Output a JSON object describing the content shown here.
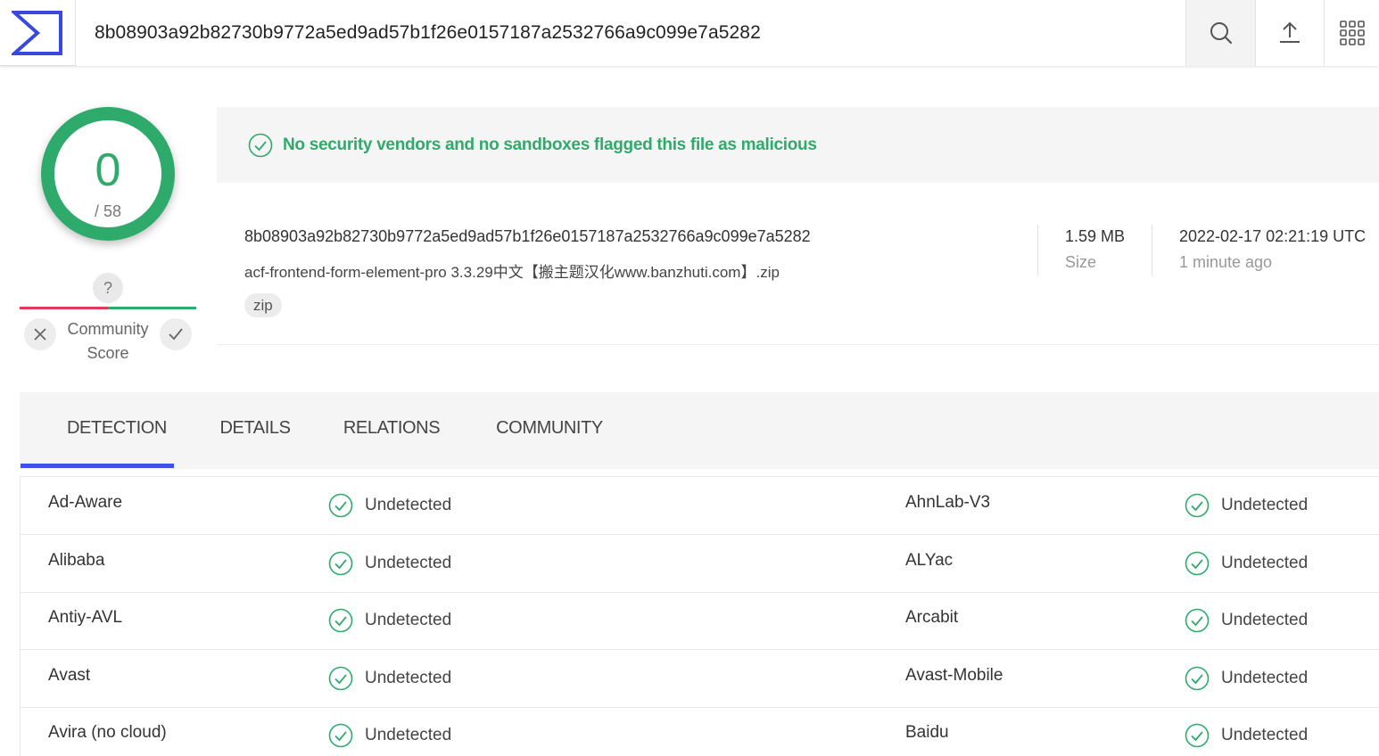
{
  "search": {
    "value": "8b08903a92b82730b9772a5ed9ad57b1f26e0157187a2532766a9c099e7a5282"
  },
  "score": {
    "detected": "0",
    "total": "/ 58"
  },
  "community": {
    "unknown": "?",
    "label": "Community Score"
  },
  "banner": {
    "text": "No security vendors and no sandboxes flagged this file as malicious"
  },
  "file": {
    "hash": "8b08903a92b82730b9772a5ed9ad57b1f26e0157187a2532766a9c099e7a5282",
    "name": "acf-frontend-form-element-pro 3.3.29中文【搬主题汉化www.banzhuti.com】.zip",
    "tag": "zip",
    "size": "1.59 MB",
    "size_label": "Size",
    "date": "2022-02-17 02:21:19 UTC",
    "date_ago": "1 minute ago"
  },
  "tabs": [
    "DETECTION",
    "DETAILS",
    "RELATIONS",
    "COMMUNITY"
  ],
  "detections": [
    [
      {
        "vendor": "Ad-Aware",
        "result": "Undetected"
      },
      {
        "vendor": "AhnLab-V3",
        "result": "Undetected"
      }
    ],
    [
      {
        "vendor": "Alibaba",
        "result": "Undetected"
      },
      {
        "vendor": "ALYac",
        "result": "Undetected"
      }
    ],
    [
      {
        "vendor": "Antiy-AVL",
        "result": "Undetected"
      },
      {
        "vendor": "Arcabit",
        "result": "Undetected"
      }
    ],
    [
      {
        "vendor": "Avast",
        "result": "Undetected"
      },
      {
        "vendor": "Avast-Mobile",
        "result": "Undetected"
      }
    ],
    [
      {
        "vendor": "Avira (no cloud)",
        "result": "Undetected"
      },
      {
        "vendor": "Baidu",
        "result": "Undetected"
      }
    ]
  ],
  "colors": {
    "clean": "#2eab6b",
    "malicious": "#e2385b",
    "accent": "#3f51e8"
  },
  "icons": {
    "logo": "sigma-logo-icon",
    "search": "search-icon",
    "upload": "upload-icon",
    "apps": "apps-grid-icon",
    "clean": "check-circle-icon"
  }
}
